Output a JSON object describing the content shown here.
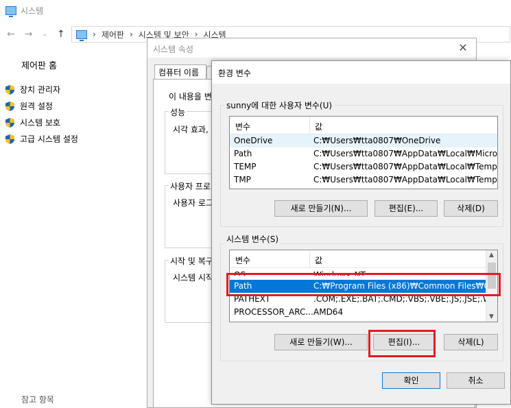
{
  "system_window": {
    "title": "시스템",
    "breadcrumb": [
      "제어판",
      "시스템 및 보안",
      "시스템"
    ],
    "sidebar_home": "제어판 홈",
    "sidebar_items": [
      "장치 관리자",
      "원격 설정",
      "시스템 보호",
      "고급 시스템 설정"
    ],
    "see_also": "참고 항목"
  },
  "properties_dialog": {
    "title": "시스템 속성",
    "tab_label": "컴퓨터 이름",
    "intro_text": "이 내용을 변",
    "performance_label": "성능",
    "performance_text": "시각 효과,",
    "profile_label": "사용자 프로",
    "profile_text": "사용자 로그",
    "startup_label": "시작 및 복구",
    "startup_text": "시스템 시작"
  },
  "env_dialog": {
    "title": "환경 변수",
    "user_section_label": "sunny에 대한 사용자 변수(U)",
    "col_variable": "변수",
    "col_value": "값",
    "user_vars": [
      {
        "name": "OneDrive",
        "value": "C:₩Users₩tta0807₩OneDrive"
      },
      {
        "name": "Path",
        "value": "C:₩Users₩tta0807₩AppData₩Local₩Micro..."
      },
      {
        "name": "TEMP",
        "value": "C:₩Users₩tta0807₩AppData₩Local₩Temp"
      },
      {
        "name": "TMP",
        "value": "C:₩Users₩tta0807₩AppData₩Local₩Temp"
      }
    ],
    "user_buttons": {
      "new": "새로 만들기(N)...",
      "edit": "편집(E)...",
      "delete": "삭제(D)"
    },
    "system_section_label": "시스템 변수(S)",
    "system_vars": [
      {
        "name": "OS",
        "value": "Windows_NT"
      },
      {
        "name": "Path",
        "value": "C:₩Program Files (x86)₩Common Files₩Or..."
      },
      {
        "name": "PATHEXT",
        "value": ".COM;.EXE;.BAT;.CMD;.VBS;.VBE;.JS;.JSE;.W..."
      },
      {
        "name": "PROCESSOR_ARC...",
        "value": "AMD64"
      }
    ],
    "system_buttons": {
      "new": "새로 만들기(W)...",
      "edit": "편집(I)...",
      "delete": "삭제(L)"
    },
    "ok": "확인",
    "cancel": "취소"
  },
  "colors": {
    "selection": "#0078d7",
    "highlight_box": "#e01b24",
    "dialog_bg": "#f0f0f0"
  }
}
